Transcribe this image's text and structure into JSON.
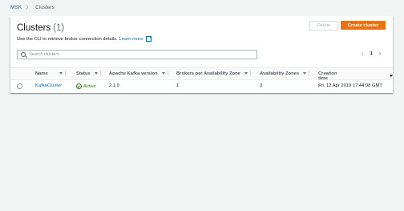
{
  "breadcrumb": {
    "root": "MSK",
    "separator": "〉",
    "current": "Clusters"
  },
  "header": {
    "title": "Clusters",
    "count": "(1)",
    "description": "Use the CLI to retrieve broker connection details.",
    "learn_more": "Learn more",
    "delete_label": "Delete",
    "create_label": "Create cluster"
  },
  "search": {
    "placeholder": "Search clusters",
    "value": ""
  },
  "pagination": {
    "prev": "‹",
    "page": "1",
    "next": "›"
  },
  "table": {
    "columns": [
      "Name",
      "Status",
      "Apache Kafka version",
      "Brokers per Availability Zone",
      "Availability Zones",
      "Creation time"
    ],
    "rows": [
      {
        "name": "KafkaCluster",
        "status": "Active",
        "kafka_version": "2.1.0",
        "brokers_per_az": "1",
        "availability_zones": "3",
        "creation_time": "Fri, 12 Apr 2019 17:44:08 GMT"
      }
    ]
  },
  "colors": {
    "accent": "#ec7211",
    "link": "#0073bb",
    "success": "#1d8102"
  },
  "icons": {
    "search": "search-icon",
    "external": "external-link-icon",
    "status": "check-circle-icon"
  }
}
